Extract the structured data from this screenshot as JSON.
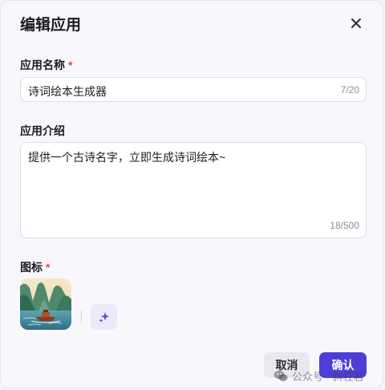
{
  "dialog": {
    "title": "编辑应用"
  },
  "name_field": {
    "label": "应用名称",
    "required_mark": "*",
    "value": "诗词绘本生成器",
    "counter": "7/20"
  },
  "description_field": {
    "label": "应用介绍",
    "value": "提供一个古诗名字，立即生成诗词绘本~",
    "counter": "18/500"
  },
  "icon_field": {
    "label": "图标",
    "required_mark": "*"
  },
  "footer": {
    "cancel_label": "取消",
    "confirm_label": "确认"
  },
  "watermark": {
    "text": "公众号 · 斜杠君"
  },
  "icons": {
    "close": "close-icon",
    "ai_generate": "sparkle-icon",
    "wechat": "wechat-icon"
  },
  "colors": {
    "accent": "#4c3fd8",
    "required": "#f04438",
    "ai_button_bg": "#ede9fb"
  }
}
